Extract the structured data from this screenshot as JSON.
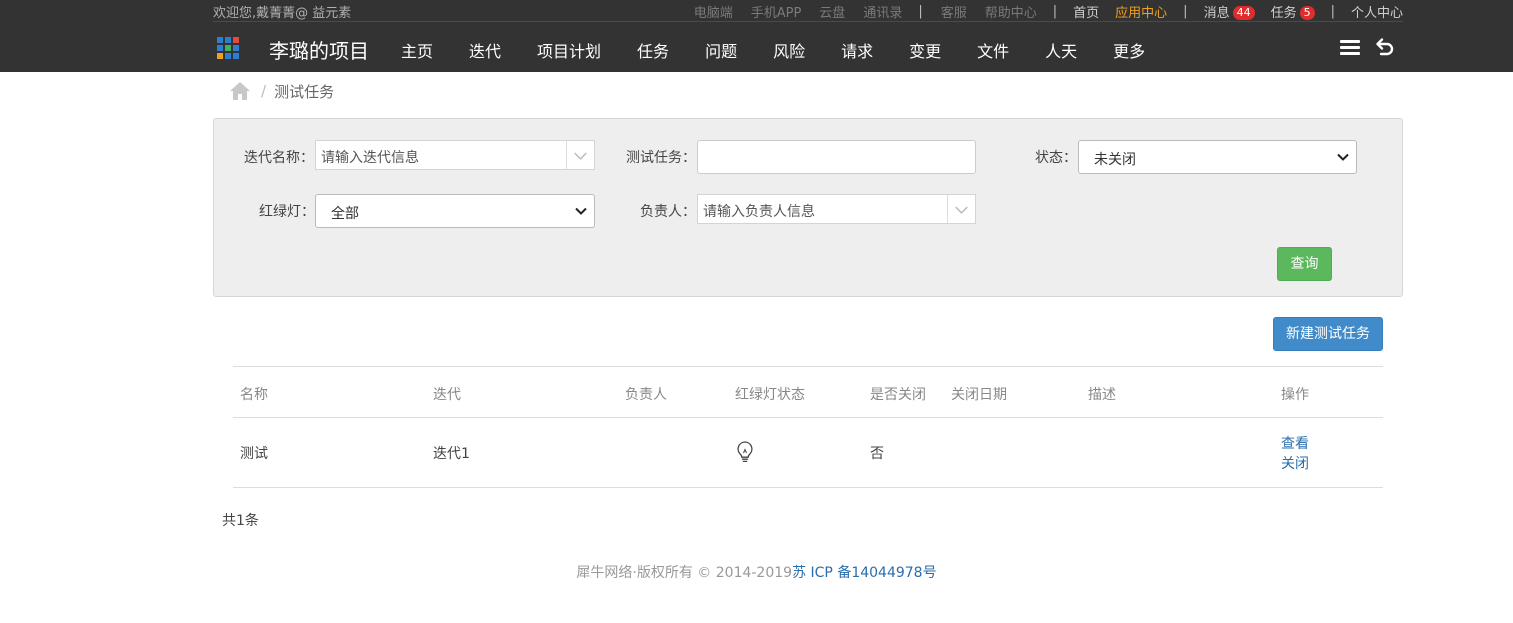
{
  "top_util": {
    "welcome": "欢迎您,戴菁菁@ 益元素",
    "links_muted": [
      "电脑端",
      "手机APP",
      "云盘",
      "通讯录"
    ],
    "links_muted2": [
      "客服",
      "帮助中心"
    ],
    "home": "首页",
    "app_center": "应用中心",
    "messages_label": "消息",
    "messages_count": "44",
    "tasks_label": "任务",
    "tasks_count": "5",
    "personal_center": "个人中心",
    "separator": "|"
  },
  "nav": {
    "project_title": "李璐的项目",
    "items": [
      "主页",
      "迭代",
      "项目计划",
      "任务",
      "问题",
      "风险",
      "请求",
      "变更",
      "文件",
      "人天",
      "更多"
    ],
    "grid_colors": [
      "#2d7dd2",
      "#2d7dd2",
      "#e34c3c",
      "#2d7dd2",
      "#40b35a",
      "#2d7dd2",
      "#f0a020",
      "#2d7dd2",
      "#2d7dd2"
    ]
  },
  "breadcrumb": {
    "separator": "/",
    "current": "测试任务"
  },
  "filter": {
    "iteration_label": "迭代名称：",
    "iteration_placeholder": "请输入迭代信息",
    "test_task_label": "测试任务：",
    "test_task_value": "",
    "status_label": "状态：",
    "status_value": "未关闭",
    "light_label": "红绿灯：",
    "light_value": "全部",
    "owner_label": "负责人：",
    "owner_placeholder": "请输入负责人信息",
    "query_button": "查询"
  },
  "new_button": "新建测试任务",
  "table": {
    "headers": [
      "名称",
      "迭代",
      "负责人",
      "红绿灯状态",
      "是否关闭",
      "关闭日期",
      "描述",
      "操作"
    ],
    "rows": [
      {
        "name": "测试",
        "iteration": "迭代1",
        "owner": "",
        "light": "bulb-icon",
        "closed": "否",
        "close_date": "",
        "desc": "",
        "actions": [
          "查看",
          "关闭"
        ]
      }
    ]
  },
  "total": "共1条",
  "footer": {
    "text": "犀牛网络·版权所有 © 2014-2019",
    "icp": "苏 ICP 备14044978号"
  },
  "colors": {
    "topbar": "#333333",
    "accent_orange": "#f0a020",
    "badge_red": "#e02c2c",
    "btn_green": "#5cb85c",
    "btn_blue": "#428bca",
    "link_blue": "#2a6dad"
  }
}
